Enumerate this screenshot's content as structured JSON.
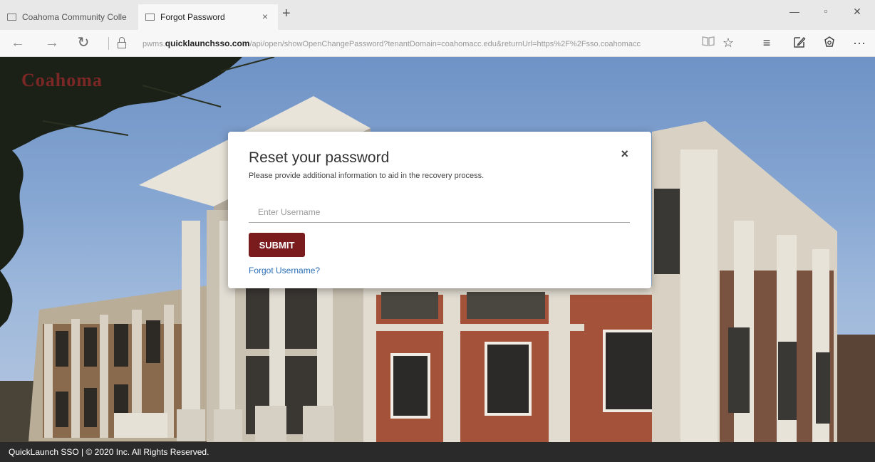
{
  "browser": {
    "tabs": [
      {
        "label": "Coahoma Community Colle"
      },
      {
        "label": "Forgot Password",
        "close": "×"
      }
    ],
    "new_tab": "+",
    "window_controls": {
      "minimize": "—",
      "maximize": "▫",
      "close": "✕"
    },
    "url": {
      "prefix": "pwms.",
      "domain": "quicklaunchsso.com",
      "path": "/api/open/showOpenChangePassword?tenantDomain=coahomacc.edu&returnUrl=https%2F%2Fsso.coahomacc"
    },
    "nav": {
      "back": "←",
      "forward": "→",
      "refresh": "↻"
    },
    "toolbar": {
      "reading_view": "📖",
      "favorite": "☆",
      "hub": "≡",
      "notes": "✎",
      "share": "♲",
      "more": "···"
    }
  },
  "page": {
    "logo_text": "Coahoma",
    "modal": {
      "title": "Reset your password",
      "close": "×",
      "subtitle": "Please provide additional information to aid in the recovery process.",
      "username_placeholder": "Enter Username",
      "username_value": "",
      "submit_label": "SUBMIT",
      "forgot_username_label": "Forgot Username?"
    },
    "footer_text": "QuickLaunch SSO | © 2020 Inc. All Rights Reserved."
  },
  "colors": {
    "submit_bg": "#7a1b1e",
    "link": "#2b6fb6",
    "footer_bg": "#2a2a2a"
  }
}
